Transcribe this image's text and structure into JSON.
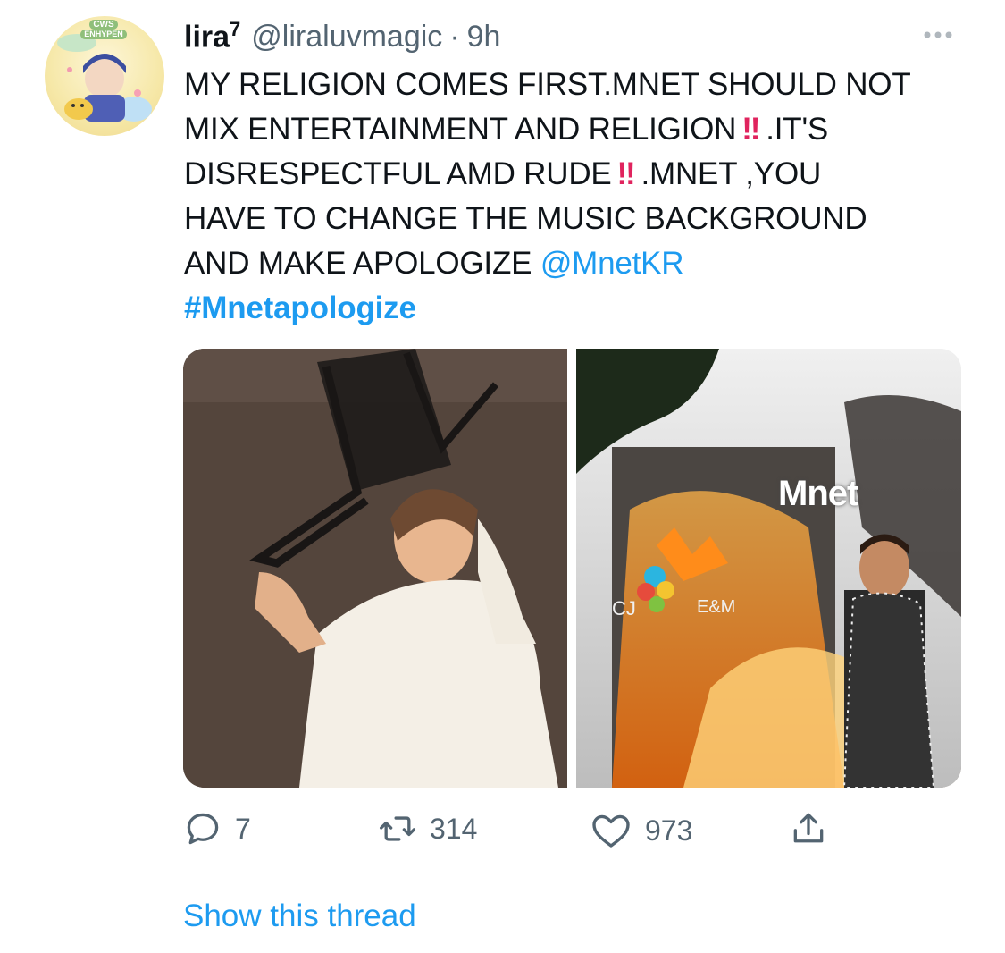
{
  "tweet": {
    "author": {
      "name": "lira",
      "name_sup": "7",
      "handle": "@liraluvmagic",
      "separator": "·",
      "time": "9h"
    },
    "text": {
      "line1": "MY RELIGION COMES FIRST.MNET SHOULD NOT",
      "line2": "MIX ENTERTAINMENT AND RELIGION",
      "line2_end": ".IT'S",
      "line3": "DISRESPECTFUL AMD RUDE",
      "line3_end": ".MNET ,YOU",
      "line4": "HAVE TO CHANGE THE MUSIC BACKGROUND",
      "line5": "AND MAKE APOLOGIZE",
      "mention": "@MnetKR",
      "hashtag": "#Mnetapologize",
      "bang": "‼"
    },
    "media": {
      "image2": {
        "logo": "Mnet",
        "cj_label": "CJ",
        "em_label": "E&M"
      }
    },
    "actions": {
      "reply_count": "7",
      "retweet_count": "314",
      "like_count": "973"
    },
    "show_thread": "Show this thread",
    "avatar_badge": {
      "top": "CWS",
      "bottom": "ENHYPEN"
    }
  },
  "colors": {
    "link": "#1d9bf0",
    "bang": "#e0245e",
    "muted": "#536471"
  },
  "icons": [
    "more-icon",
    "reply-icon",
    "retweet-icon",
    "like-icon",
    "share-icon"
  ]
}
